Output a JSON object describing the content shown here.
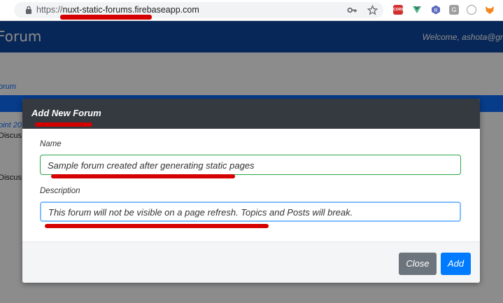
{
  "browser": {
    "url_scheme": "https://",
    "url_host": "nuxt-static-forums.firebaseapp.com",
    "extensions": [
      {
        "name": "cors-extension-icon",
        "label": "CORS"
      },
      {
        "name": "vue-devtools-icon"
      },
      {
        "name": "hexagon-extension-icon"
      },
      {
        "name": "g-extension-icon",
        "label": "G"
      },
      {
        "name": "circle-extension-icon"
      },
      {
        "name": "fox-extension-icon"
      }
    ]
  },
  "app": {
    "brand": "Forum",
    "welcome": "Welcome, ashota@gm",
    "breadcrumb": "orum",
    "row1": "oint 20",
    "row2": "Discus",
    "row3": "Discus"
  },
  "modal": {
    "title": "Add New Forum",
    "name_label": "Name",
    "name_value": "Sample forum created after generating static pages",
    "description_label": "Description",
    "description_value": "This forum will not be visible on a page refresh. Topics and Posts will break.",
    "close_label": "Close",
    "add_label": "Add"
  },
  "colors": {
    "navbar": "#0d47a1",
    "modal_header": "#343a40",
    "add_button": "#007bff",
    "close_button": "#6c757d",
    "annotation": "#d50000"
  }
}
